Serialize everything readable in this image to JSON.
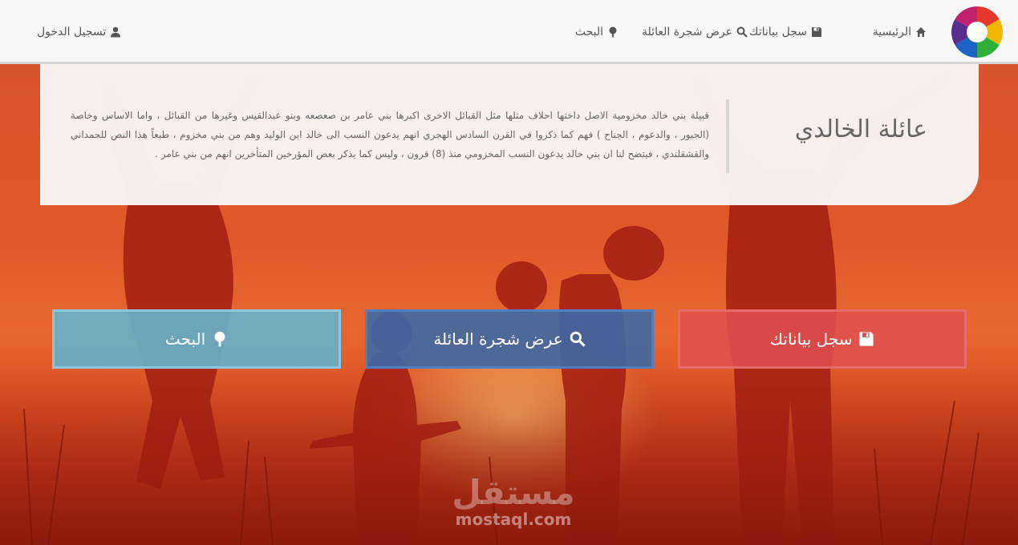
{
  "navbar": {
    "home_label": "الرئيسية",
    "register_label": "سجل بياناتك",
    "tree_label": "عرض شجرة العائلة",
    "search_label": "البحث",
    "login_label": "تسجيل الدخول"
  },
  "card": {
    "title": "عائلة الخالدي",
    "text": "قبيلة بني خالد مخزومية الاصل داختها احلاف مثلها مثل القبائل الاخرى اكبرها بني عامر بن صعصعه وبنو عبدالقيس وغيرها من القبائل ، واما الاساس وخاصة (الجبور ، والدعوم ، الجناح ) فهم كما ذكروا في القرن السادس الهجري انهم يدعون النسب الى خالد ابن الوليد وهم من بني مخزوم ، طبعاً هذا النص للحمداني والقشقلندي ، فيتضح لنا ان بني خالد يدعون النسب المخزومي منذ (8) قرون ، وليس كما يذكر بعض المؤرخين المتأخرين انهم من بني عامر ."
  },
  "actions": {
    "register_label": "سجل بياناتك",
    "tree_label": "عرض شجرة العائلة",
    "search_label": "البحث"
  },
  "watermark": {
    "arabic": "مستقل",
    "latin": "mostaql.com"
  },
  "icons": {
    "home": "home-icon",
    "register": "floppy-disk-icon",
    "tree": "magnifier-icon",
    "search": "tree-icon",
    "login": "user-icon"
  },
  "colors": {
    "register_button": "#e05050",
    "tree_button": "#3d68a4",
    "search_button": "#66b0c8",
    "hero": "#d8542a"
  }
}
